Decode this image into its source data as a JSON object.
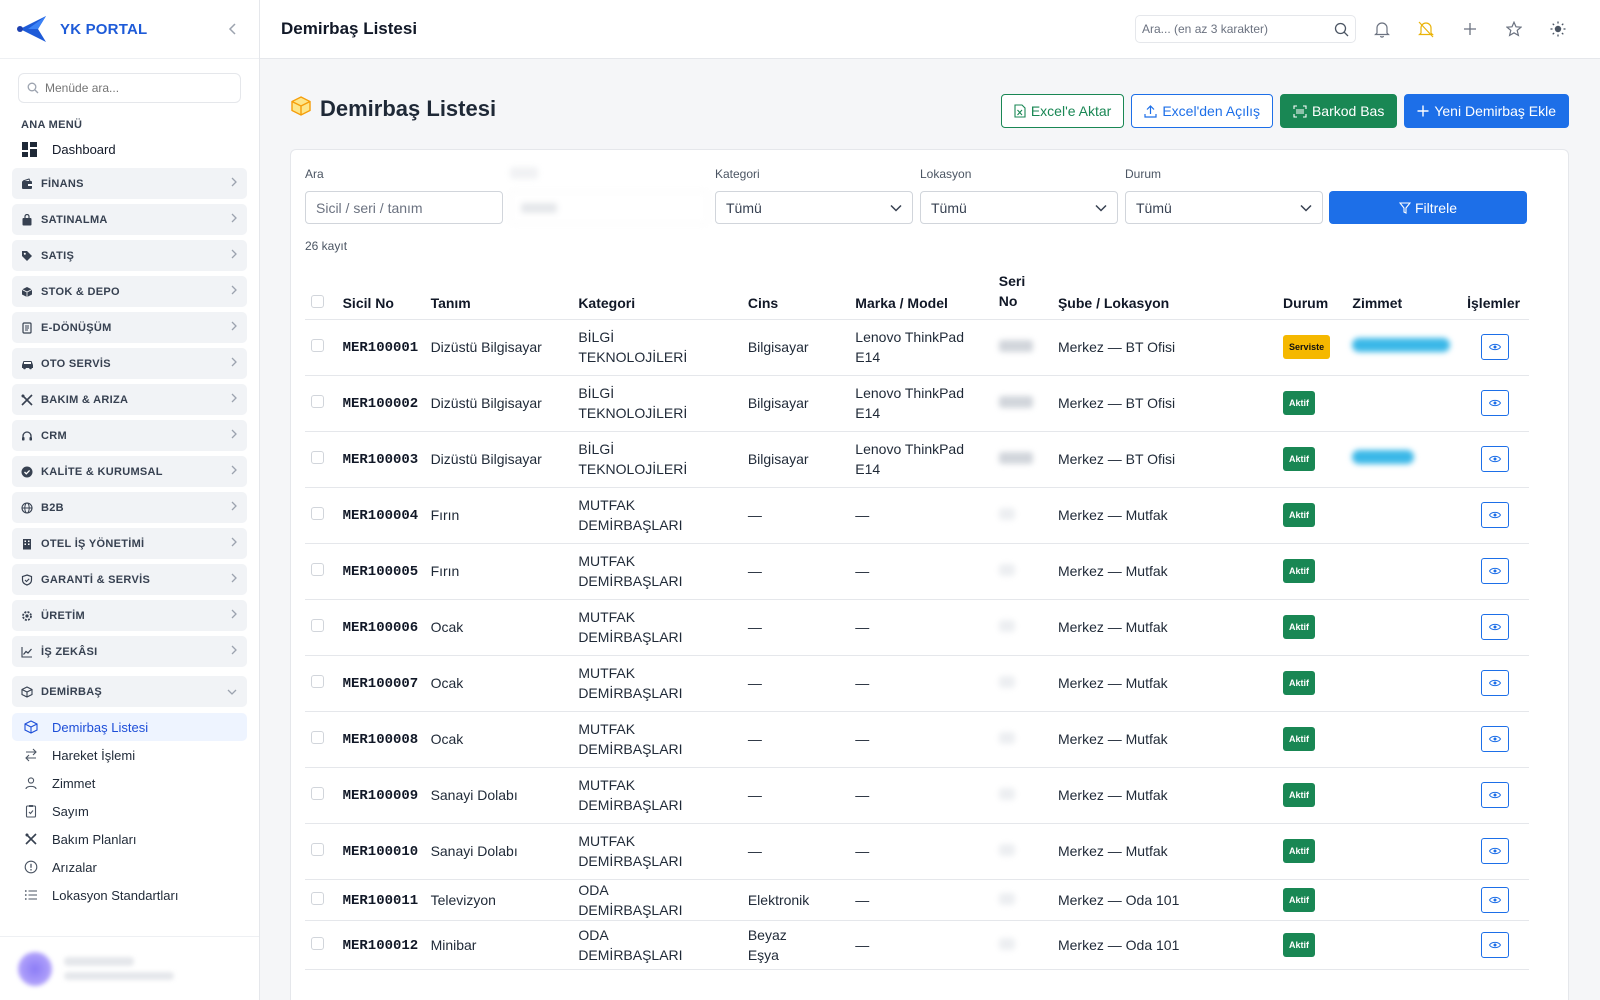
{
  "brand": {
    "name": "YK PORTAL",
    "accent": "#1e5bd8"
  },
  "sidebar": {
    "search_placeholder": "Menüde ara...",
    "section_title": "ANA MENÜ",
    "dashboard_label": "Dashboard",
    "groups": [
      {
        "label": "FİNANS",
        "icon": "wallet-icon"
      },
      {
        "label": "SATINALMA",
        "icon": "bag-icon"
      },
      {
        "label": "SATIŞ",
        "icon": "tag-icon"
      },
      {
        "label": "STOK & DEPO",
        "icon": "box-icon"
      },
      {
        "label": "E-DÖNÜŞÜM",
        "icon": "document-icon"
      },
      {
        "label": "OTO SERVİS",
        "icon": "car-icon"
      },
      {
        "label": "BAKIM & ARIZA",
        "icon": "tools-icon"
      },
      {
        "label": "CRM",
        "icon": "headset-icon"
      },
      {
        "label": "KALİTE & KURUMSAL",
        "icon": "badge-check-icon"
      },
      {
        "label": "B2B",
        "icon": "globe-icon"
      },
      {
        "label": "OTEL İŞ YÖNETİMİ",
        "icon": "building-icon"
      },
      {
        "label": "GARANTİ & SERVİS",
        "icon": "shield-icon"
      },
      {
        "label": "ÜRETİM",
        "icon": "gear-icon"
      },
      {
        "label": "İŞ ZEKÂSI",
        "icon": "chart-icon"
      }
    ],
    "open_group": {
      "label": "DEMİRBAŞ",
      "icon": "cube-icon"
    },
    "sub_items": [
      {
        "label": "Demirbaş Listesi",
        "icon": "cube-icon",
        "active": true
      },
      {
        "label": "Hareket İşlemi",
        "icon": "arrows-icon",
        "active": false
      },
      {
        "label": "Zimmet",
        "icon": "user-icon",
        "active": false
      },
      {
        "label": "Sayım",
        "icon": "clipboard-icon",
        "active": false
      },
      {
        "label": "Bakım Planları",
        "icon": "tools-icon",
        "active": false
      },
      {
        "label": "Arızalar",
        "icon": "alert-icon",
        "active": false
      },
      {
        "label": "Lokasyon Standartları",
        "icon": "list-icon",
        "active": false
      }
    ]
  },
  "topbar": {
    "title": "Demirbaş Listesi",
    "search_placeholder": "Ara... (en az 3 karakter)"
  },
  "page": {
    "title": "Demirbaş Listesi",
    "buttons": {
      "excel_export": "Excel'e Aktar",
      "excel_import": "Excel'den Açılış",
      "barcode": "Barkod Bas",
      "new_item": "Yeni Demirbaş Ekle"
    },
    "filters": {
      "search_label": "Ara",
      "search_placeholder": "Sicil / seri / tanım",
      "category_label": "Kategori",
      "category_value": "Tümü",
      "location_label": "Lokasyon",
      "location_value": "Tümü",
      "status_label": "Durum",
      "status_value": "Tümü",
      "filter_button": "Filtrele"
    },
    "record_count": "26 kayıt"
  },
  "table": {
    "columns": [
      "Sicil No",
      "Tanım",
      "Kategori",
      "Cins",
      "Marka / Model",
      "Seri No",
      "Şube / Lokasyon",
      "Durum",
      "Zimmet",
      "İşlemler"
    ],
    "rows": [
      {
        "sicil": "MER100001",
        "tanim": "Dizüstü Bilgisayar",
        "kategori": "BİLGİ TEKNOLOJİLERİ",
        "cins": "Bilgisayar",
        "marka": "Lenovo ThinkPad E14",
        "lokasyon": "Merkez — BT Ofisi",
        "durum": "Serviste",
        "status_color": "#f5b800"
      },
      {
        "sicil": "MER100002",
        "tanim": "Dizüstü Bilgisayar",
        "kategori": "BİLGİ TEKNOLOJİLERİ",
        "cins": "Bilgisayar",
        "marka": "Lenovo ThinkPad E14",
        "lokasyon": "Merkez — BT Ofisi",
        "durum": "Aktif",
        "status_color": "#198754"
      },
      {
        "sicil": "MER100003",
        "tanim": "Dizüstü Bilgisayar",
        "kategori": "BİLGİ TEKNOLOJİLERİ",
        "cins": "Bilgisayar",
        "marka": "Lenovo ThinkPad E14",
        "lokasyon": "Merkez — BT Ofisi",
        "durum": "Aktif",
        "status_color": "#198754"
      },
      {
        "sicil": "MER100004",
        "tanim": "Fırın",
        "kategori": "MUTFAK DEMİRBAŞLARI",
        "cins": "—",
        "marka": "—",
        "lokasyon": "Merkez — Mutfak",
        "durum": "Aktif",
        "status_color": "#198754"
      },
      {
        "sicil": "MER100005",
        "tanim": "Fırın",
        "kategori": "MUTFAK DEMİRBAŞLARI",
        "cins": "—",
        "marka": "—",
        "lokasyon": "Merkez — Mutfak",
        "durum": "Aktif",
        "status_color": "#198754"
      },
      {
        "sicil": "MER100006",
        "tanim": "Ocak",
        "kategori": "MUTFAK DEMİRBAŞLARI",
        "cins": "—",
        "marka": "—",
        "lokasyon": "Merkez — Mutfak",
        "durum": "Aktif",
        "status_color": "#198754"
      },
      {
        "sicil": "MER100007",
        "tanim": "Ocak",
        "kategori": "MUTFAK DEMİRBAŞLARI",
        "cins": "—",
        "marka": "—",
        "lokasyon": "Merkez — Mutfak",
        "durum": "Aktif",
        "status_color": "#198754"
      },
      {
        "sicil": "MER100008",
        "tanim": "Ocak",
        "kategori": "MUTFAK DEMİRBAŞLARI",
        "cins": "—",
        "marka": "—",
        "lokasyon": "Merkez — Mutfak",
        "durum": "Aktif",
        "status_color": "#198754"
      },
      {
        "sicil": "MER100009",
        "tanim": "Sanayi Dolabı",
        "kategori": "MUTFAK DEMİRBAŞLARI",
        "cins": "—",
        "marka": "—",
        "lokasyon": "Merkez — Mutfak",
        "durum": "Aktif",
        "status_color": "#198754"
      },
      {
        "sicil": "MER100010",
        "tanim": "Sanayi Dolabı",
        "kategori": "MUTFAK DEMİRBAŞLARI",
        "cins": "—",
        "marka": "—",
        "lokasyon": "Merkez — Mutfak",
        "durum": "Aktif",
        "status_color": "#198754"
      },
      {
        "sicil": "MER100011",
        "tanim": "Televizyon",
        "kategori": "ODA DEMİRBAŞLARI",
        "cins": "Elektronik",
        "marka": "—",
        "lokasyon": "Merkez — Oda 101",
        "durum": "Aktif",
        "status_color": "#198754"
      },
      {
        "sicil": "MER100012",
        "tanim": "Minibar",
        "kategori": "ODA DEMİRBAŞLARI",
        "cins": "Beyaz Eşya",
        "marka": "—",
        "lokasyon": "Merkez — Oda 101",
        "durum": "Aktif",
        "status_color": "#198754"
      }
    ]
  }
}
